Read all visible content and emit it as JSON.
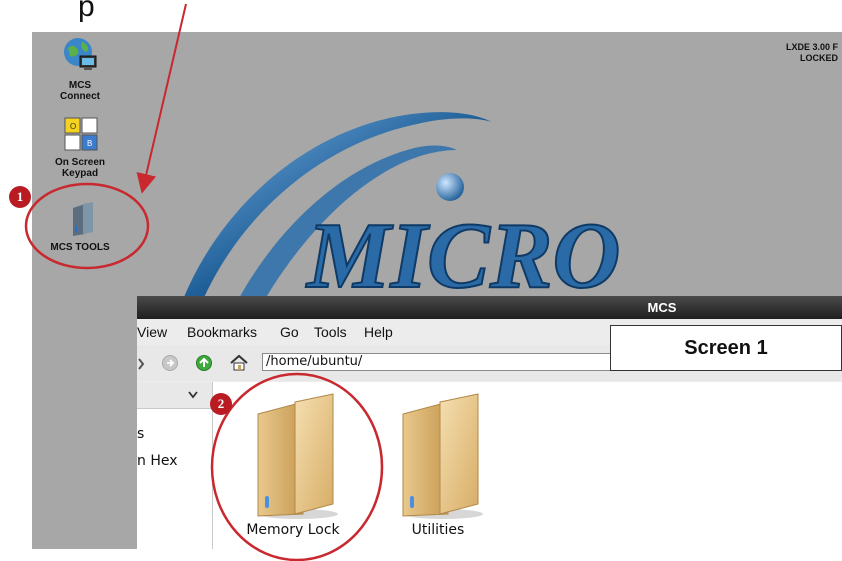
{
  "top_label_partial": "p",
  "desktop": {
    "logo_text": "MICRO",
    "status_line1": "LXDE 3.00 F",
    "status_line2": "LOCKED",
    "icons": [
      {
        "label1": "MCS",
        "label2": "Connect",
        "icon": "globe-computer-icon"
      },
      {
        "label1": "On Screen",
        "label2": "Keypad",
        "icon": "keypad-icon"
      },
      {
        "label1": "MCS TOOLS",
        "label2": "",
        "icon": "folder-tools-icon"
      }
    ]
  },
  "file_manager": {
    "title": "MCS",
    "menu": [
      "View",
      "Bookmarks",
      "Go",
      "Tools",
      "Help"
    ],
    "path": "/home/ubuntu/",
    "sidebar_items": [
      "s",
      "n Hex"
    ],
    "folders": [
      "Memory Lock",
      "Utilities"
    ]
  },
  "screen_label": "Screen 1",
  "badges": [
    "1",
    "2"
  ],
  "colors": {
    "accent_red": "#c8282e",
    "desktop_bg": "#a7a7a7",
    "logo_blue": "#1f5f98"
  }
}
